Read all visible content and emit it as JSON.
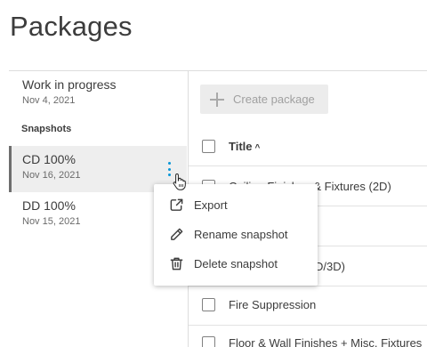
{
  "page": {
    "title": "Packages"
  },
  "sidebar": {
    "work_in_progress": {
      "name": "Work in progress",
      "date": "Nov 4, 2021"
    },
    "snapshots_label": "Snapshots",
    "snapshots": [
      {
        "name": "CD 100%",
        "date": "Nov 16, 2021",
        "selected": true
      },
      {
        "name": "DD 100%",
        "date": "Nov 15, 2021",
        "selected": false
      }
    ]
  },
  "toolbar": {
    "create_label": "Create package"
  },
  "table": {
    "header": {
      "title": "Title",
      "sort": "ascending"
    },
    "rows": [
      "Ceiling Finishes & Fixtures (2D)",
      "",
      "Walls & Doors (2D/3D)",
      "Fire Suppression",
      "Floor & Wall Finishes + Misc. Fixtures"
    ]
  },
  "context_menu": {
    "items": [
      {
        "label": "Export",
        "icon": "export-icon"
      },
      {
        "label": "Rename snapshot",
        "icon": "pencil-icon"
      },
      {
        "label": "Delete snapshot",
        "icon": "trash-icon"
      }
    ]
  },
  "colors": {
    "accent": "#0696d7",
    "selected_bg": "#eeeeee",
    "disabled_bg": "#ececec"
  }
}
